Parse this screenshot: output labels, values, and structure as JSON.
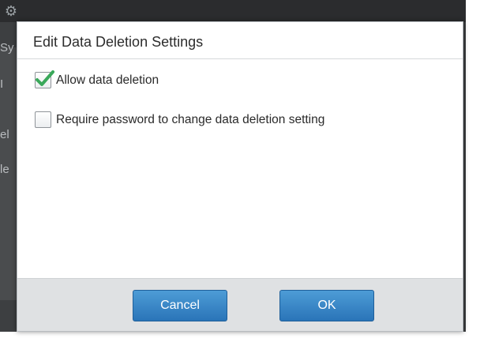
{
  "background": {
    "fragments": [
      "Sy",
      "I",
      "el",
      "le"
    ]
  },
  "dialog": {
    "title": "Edit Data Deletion Settings",
    "options": [
      {
        "label": "Allow data deletion",
        "checked": true
      },
      {
        "label": "Require password to change data deletion setting",
        "checked": false
      }
    ],
    "buttons": {
      "cancel": "Cancel",
      "ok": "OK"
    }
  },
  "colors": {
    "button_primary": "#2a74b8",
    "check_mark": "#3aa85a",
    "footer": "#dfe1e3"
  }
}
